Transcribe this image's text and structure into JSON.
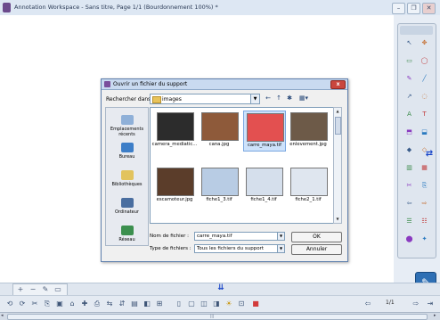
{
  "window": {
    "title": "Annotation Workspace - Sans titre, Page 1/1  (Bourdonnement 100%) *",
    "minimize": "–",
    "restore": "❐",
    "close": "✕"
  },
  "dialog": {
    "title": "Ouvrir un fichier du support",
    "close": "x",
    "look_in_label": "Rechercher dans :",
    "look_in_value": "images",
    "nav": [
      "←",
      "↑",
      "✱",
      "▦▾"
    ],
    "places": [
      {
        "label": "Emplacements récents",
        "icon": "recent-places-icon",
        "color": "#8fb0d8"
      },
      {
        "label": "Bureau",
        "icon": "desktop-icon",
        "color": "#3d7ec8"
      },
      {
        "label": "Bibliothèques",
        "icon": "libraries-icon",
        "color": "#e2c35d"
      },
      {
        "label": "Ordinateur",
        "icon": "computer-icon",
        "color": "#4a6ea0"
      },
      {
        "label": "Réseau",
        "icon": "network-icon",
        "color": "#3b8f4e"
      }
    ],
    "files": [
      {
        "name": "camera_mediatic...",
        "color": "#2c2c2c",
        "selected": false
      },
      {
        "name": "cana.jpg",
        "color": "#8e5a3a",
        "selected": false
      },
      {
        "name": "carre_maya.tif",
        "color": "#e35050",
        "selected": true
      },
      {
        "name": "enlevement.jpg",
        "color": "#6d5a48",
        "selected": false
      },
      {
        "name": "escamoteur.jpg",
        "color": "#5b3d2a",
        "selected": false
      },
      {
        "name": "fiche1_3.tif",
        "color": "#b8cce4",
        "selected": false
      },
      {
        "name": "fiche1_4.tif",
        "color": "#d5dfec",
        "selected": false
      },
      {
        "name": "fiche2_1.tif",
        "color": "#dfe6ef",
        "selected": false
      }
    ],
    "file_name_label": "Nom de fichier :",
    "file_name_value": "carre_maya.tif",
    "file_type_label": "Type de fichiers :",
    "file_type_value": "Tous les fichiers du support",
    "ok": "OK",
    "cancel": "Annuler"
  },
  "bottom": {
    "page_indicator": "1/1",
    "down_arrows": "⇊",
    "right_arrow": "⇄"
  }
}
